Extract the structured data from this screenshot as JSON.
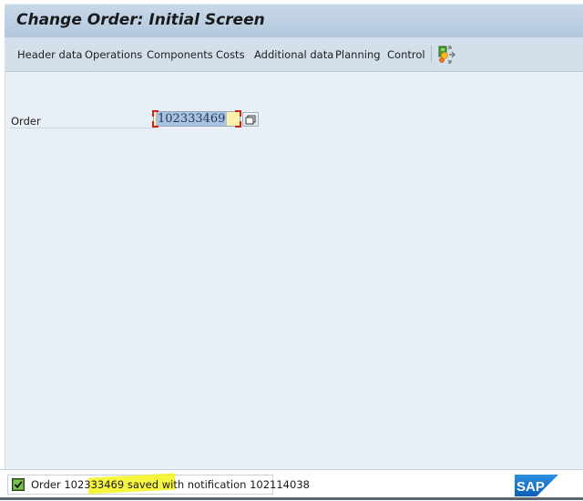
{
  "window": {
    "title": "Change Order: Initial Screen"
  },
  "toolbar": {
    "items": [
      {
        "label": "Header data"
      },
      {
        "label": "Operations"
      },
      {
        "label": "Components"
      },
      {
        "label": "Costs"
      },
      {
        "label": "Additional data"
      },
      {
        "label": "Planning"
      },
      {
        "label": "Control"
      }
    ],
    "extra_icon": "navigation-map-icon"
  },
  "form": {
    "order_label": "Order",
    "order_value": "102333469",
    "order_required": true,
    "value_help_icon": "value-help-icon"
  },
  "status": {
    "type": "success",
    "icon": "success-check-icon",
    "message": "Order 102333469 saved with notification 102114038",
    "highlight_color": "#f4f41e"
  },
  "brand": {
    "logo_text": "SAP",
    "logo_color": "#1a6fc9"
  }
}
